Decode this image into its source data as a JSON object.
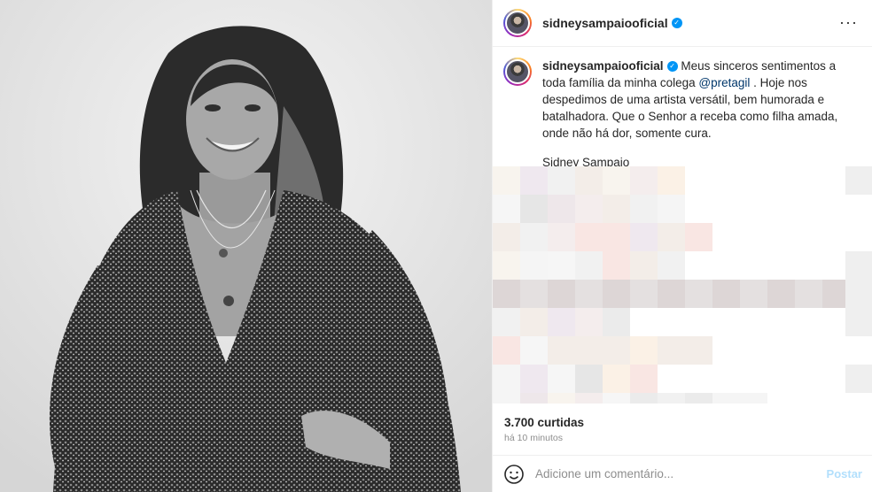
{
  "header": {
    "username": "sidneysampaiooficial",
    "more_icon": "more-horizontal-icon"
  },
  "caption": {
    "username": "sidneysampaiooficial",
    "text_before_mention": "Meus sinceros sentimentos a toda família da minha colega",
    "mention": "@pretagil",
    "text_after_mention": ". Hoje nos despedimos de uma artista versátil, bem humorada e batalhadora. Que o Senhor a receba como filha amada, onde não há dor, somente cura.",
    "signature": "Sidney Sampaio",
    "meta": "Editado · 3 min"
  },
  "likes": "3.700 curtidas",
  "time_ago": "há 10 minutos",
  "comment_bar": {
    "placeholder": "Adicione um comentário...",
    "post_label": "Postar",
    "emoji_icon": "smiley-icon"
  },
  "colors": {
    "verified": "#0095f6",
    "mention": "#00376b",
    "post_disabled": "#b2dffc"
  }
}
